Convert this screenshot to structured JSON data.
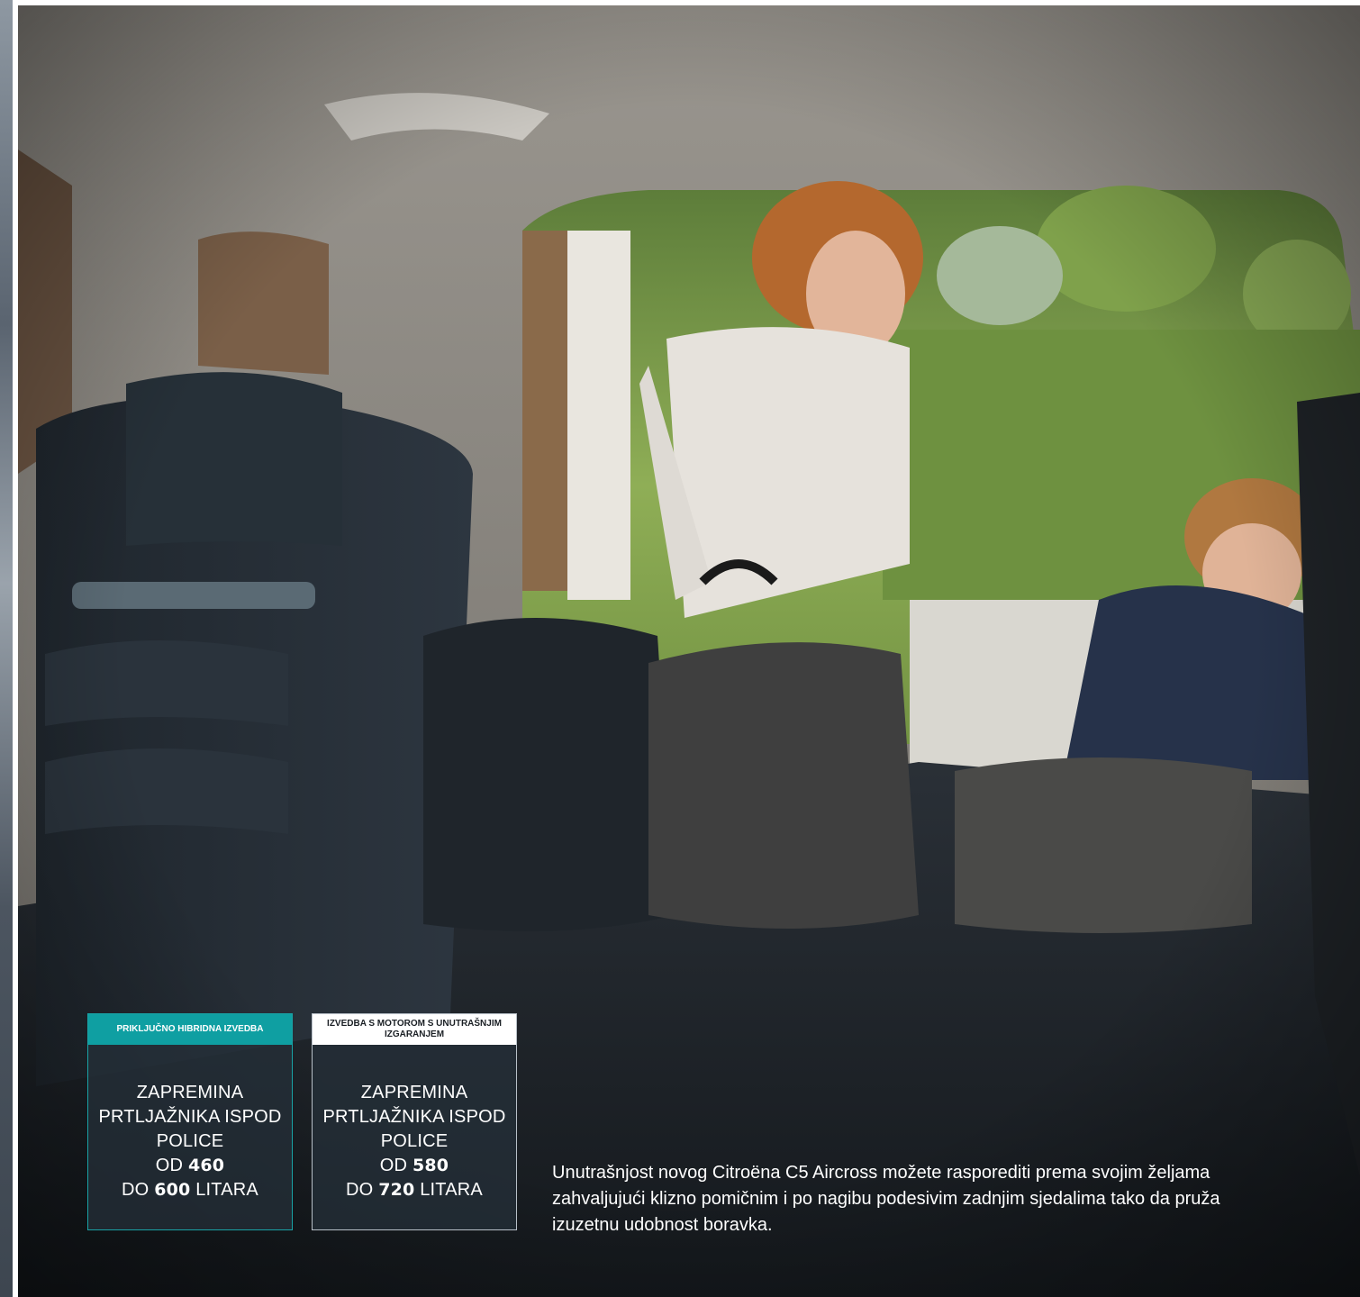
{
  "boxes": [
    {
      "header": "PRIKLJUČNO HIBRIDNA IZVEDBA",
      "line1": "ZAPREMINA",
      "line2": "PRTLJAŽNIKA ISPOD",
      "line3": "POLICE",
      "from_label": "OD",
      "from_value": "460",
      "to_label": "DO",
      "to_value": "600",
      "unit": "LITARA"
    },
    {
      "header": "IZVEDBA S MOTOROM S UNUTRAŠNJIM IZGARANJEM",
      "line1": "ZAPREMINA",
      "line2": "PRTLJAŽNIKA ISPOD",
      "line3": "POLICE",
      "from_label": "OD",
      "from_value": "580",
      "to_label": "DO",
      "to_value": "720",
      "unit": "LITARA"
    }
  ],
  "caption": "Unutrašnjost novog Citroëna C5 Aircross možete rasporediti prema svojim željama zahvaljujući klizno pomičnim i po nagibu podesivim zadnjim sjedalima tako da pruža izuzetnu udobnost boravka.",
  "colors": {
    "hybrid_accent": "#0f9fa2",
    "ice_header": "#ffffff",
    "box_background": "#26303a"
  }
}
